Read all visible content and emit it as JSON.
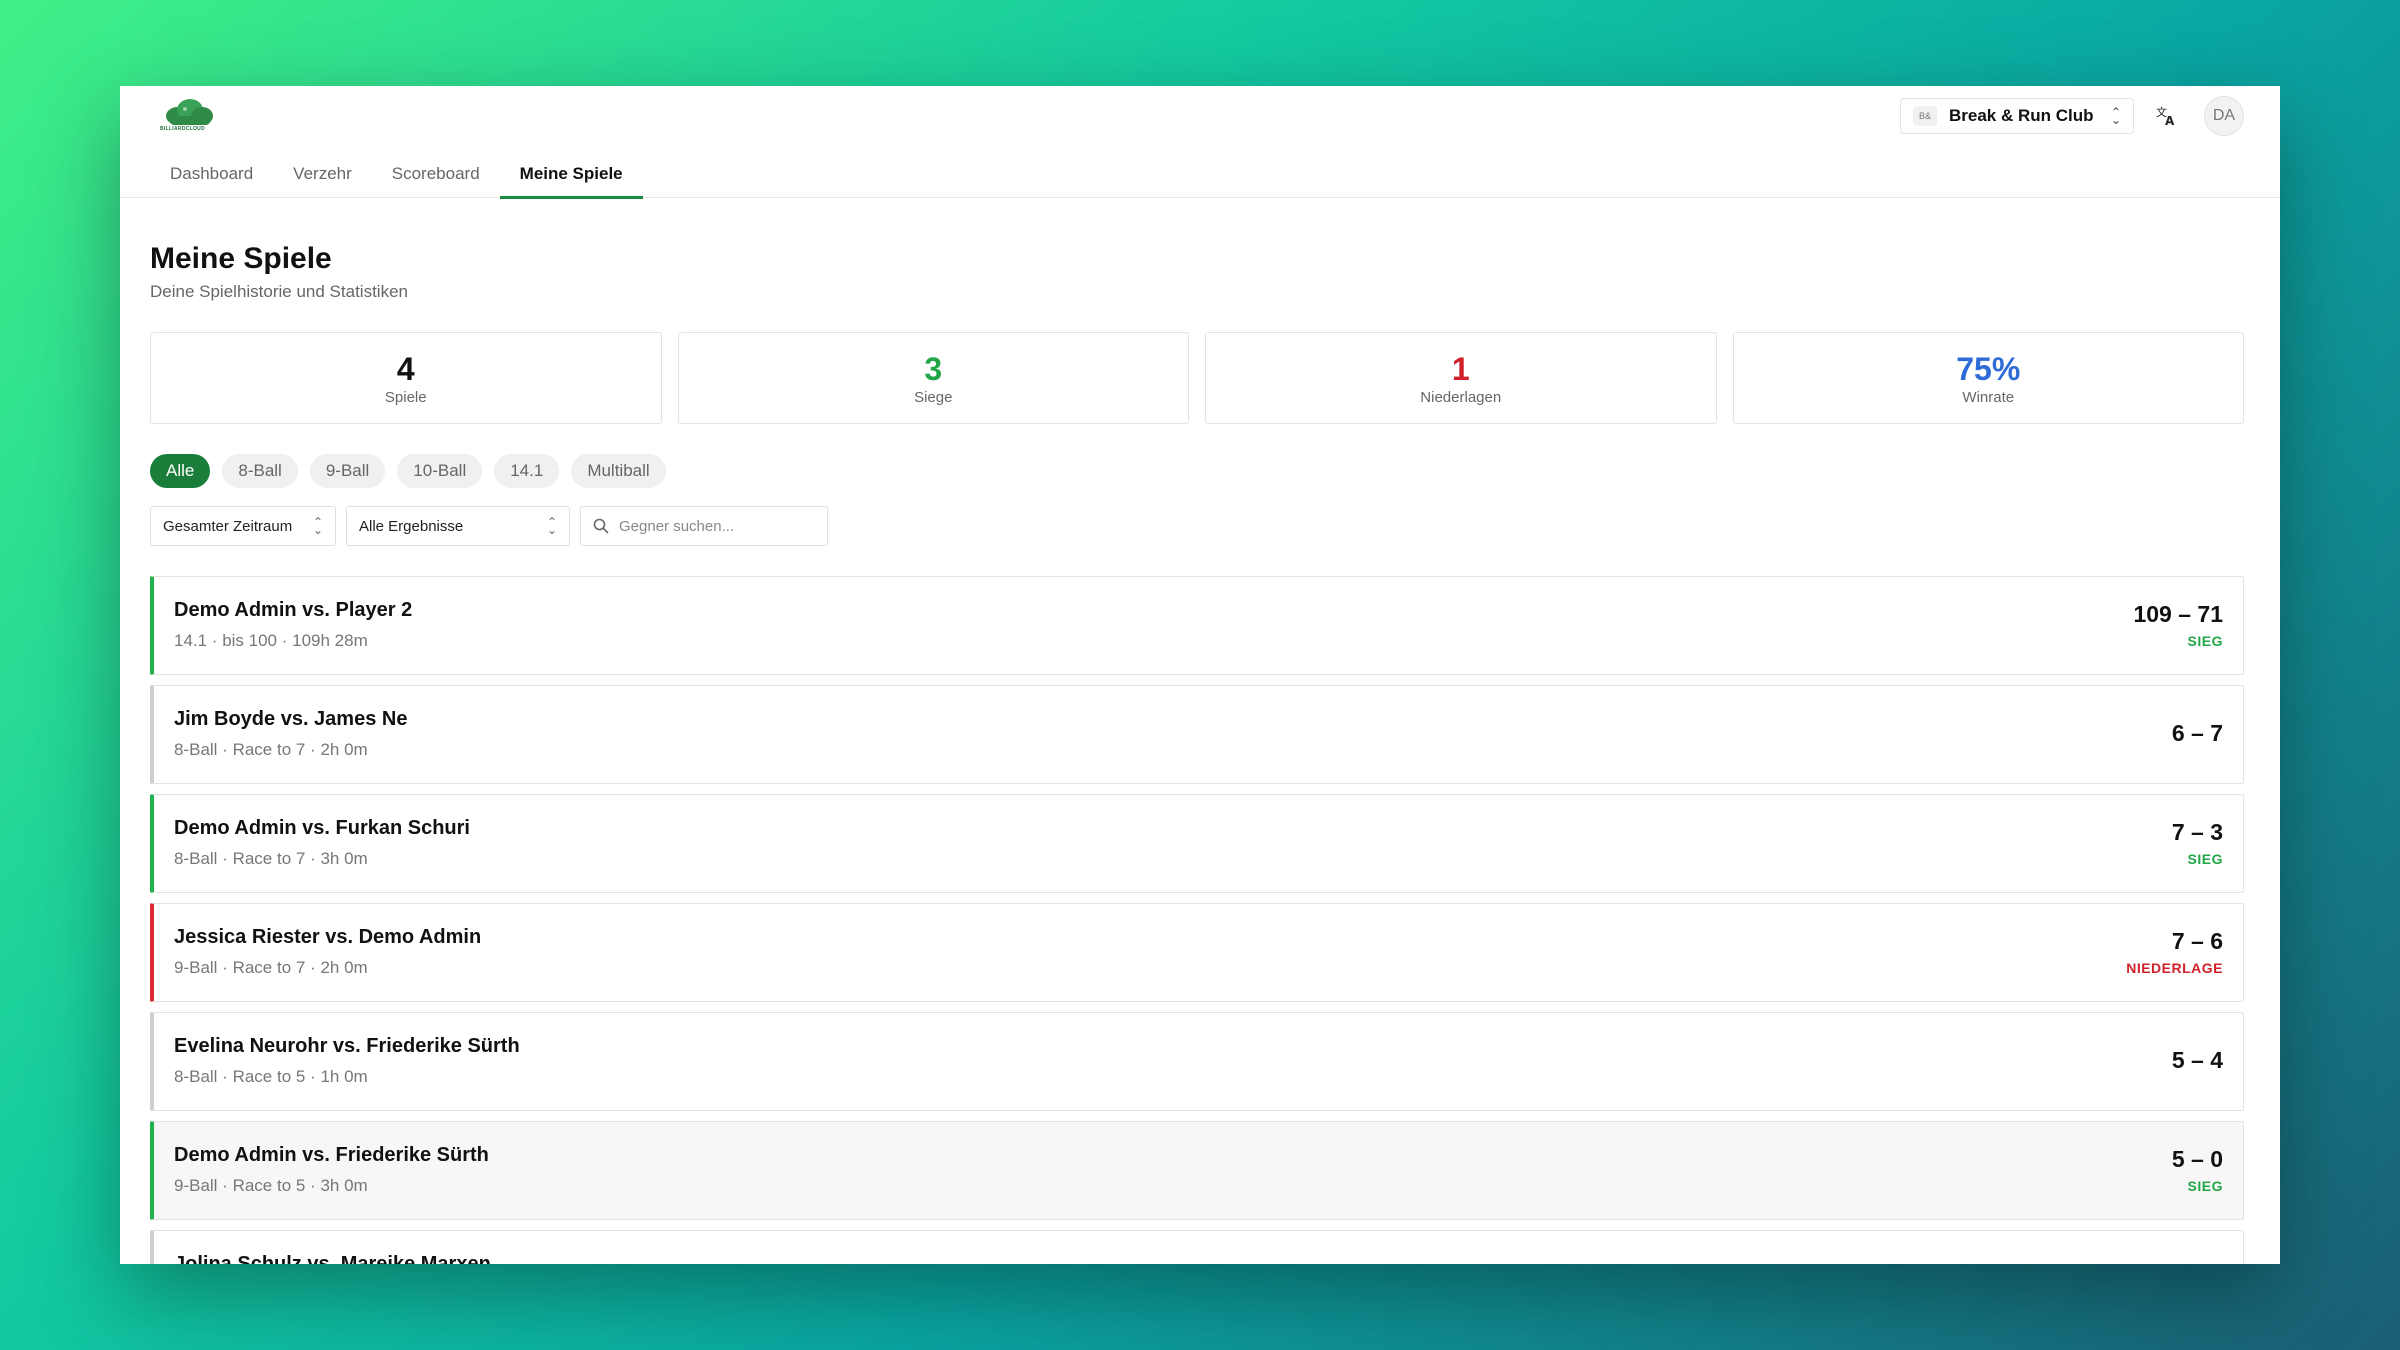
{
  "logo": {
    "text": "BILLIARDCLOUD"
  },
  "header": {
    "club_badge": "B&",
    "club_name": "Break & Run Club",
    "avatar": "DA"
  },
  "nav": {
    "tabs": [
      {
        "label": "Dashboard"
      },
      {
        "label": "Verzehr"
      },
      {
        "label": "Scoreboard"
      },
      {
        "label": "Meine Spiele",
        "active": true
      }
    ]
  },
  "page": {
    "title": "Meine Spiele",
    "subtitle": "Deine Spielhistorie und Statistiken"
  },
  "stats": [
    {
      "value": "4",
      "label": "Spiele",
      "color": "#111111"
    },
    {
      "value": "3",
      "label": "Siege",
      "color": "#22a647"
    },
    {
      "value": "1",
      "label": "Niederlagen",
      "color": "#d0202a"
    },
    {
      "value": "75%",
      "label": "Winrate",
      "color": "#2e6bd6"
    }
  ],
  "filters": {
    "pills": [
      "Alle",
      "8-Ball",
      "9-Ball",
      "10-Ball",
      "14.1",
      "Multiball"
    ],
    "active_pill": "Alle",
    "period": "Gesamter Zeitraum",
    "results": "Alle Ergebnisse",
    "search_placeholder": "Gegner suchen..."
  },
  "games": [
    {
      "title": "Demo Admin vs. Player 2",
      "meta": "14.1 · bis 100 · 109h 28m",
      "score": "109 – 71",
      "result": "SIEG",
      "status": "win"
    },
    {
      "title": "Jim Boyde vs. James Ne",
      "meta": "8-Ball · Race to 7 · 2h 0m",
      "score": "6 – 7",
      "result": "",
      "status": "neutral"
    },
    {
      "title": "Demo Admin vs. Furkan Schuri",
      "meta": "8-Ball · Race to 7 · 3h 0m",
      "score": "7 – 3",
      "result": "SIEG",
      "status": "win"
    },
    {
      "title": "Jessica Riester vs. Demo Admin",
      "meta": "9-Ball · Race to 7 · 2h 0m",
      "score": "7 – 6",
      "result": "NIEDERLAGE",
      "status": "loss"
    },
    {
      "title": "Evelina Neurohr vs. Friederike Sürth",
      "meta": "8-Ball · Race to 5 · 1h 0m",
      "score": "5 – 4",
      "result": "",
      "status": "neutral"
    },
    {
      "title": "Demo Admin vs. Friederike Sürth",
      "meta": "9-Ball · Race to 5 · 3h 0m",
      "score": "5 – 0",
      "result": "SIEG",
      "status": "win",
      "highlight": true
    },
    {
      "title": "Jolina Schulz vs. Mareike Marxen",
      "meta": "",
      "score": "",
      "result": "",
      "status": "neutral"
    }
  ]
}
